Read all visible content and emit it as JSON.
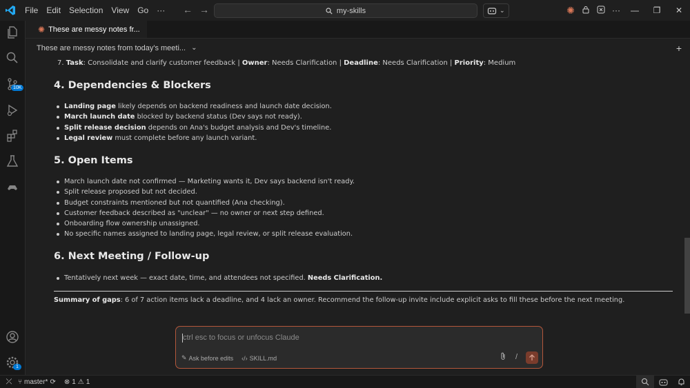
{
  "menu": [
    "File",
    "Edit",
    "Selection",
    "View",
    "Go"
  ],
  "search": {
    "text": "my-skills"
  },
  "tab": {
    "label": "These are messy notes fr..."
  },
  "subheader": {
    "title": "These are messy notes from today's meeti..."
  },
  "activity_badges": {
    "source_control": "10K",
    "settings": "1"
  },
  "doc": {
    "item7": {
      "number": "7.",
      "task_label": "Task",
      "task": ": Consolidate and clarify customer feedback | ",
      "owner_label": "Owner",
      "owner": ": Needs Clarification | ",
      "deadline_label": "Deadline",
      "deadline": ": Needs Clarification | ",
      "priority_label": "Priority",
      "priority": ": Medium"
    },
    "section4": {
      "heading": "4. Dependencies & Blockers",
      "items": [
        {
          "bold": "Landing page",
          "text": " likely depends on backend readiness and launch date decision."
        },
        {
          "bold": "March launch date",
          "text": " blocked by backend status (Dev says not ready)."
        },
        {
          "bold": "Split release decision",
          "text": " depends on Ana's budget analysis and Dev's timeline."
        },
        {
          "bold": "Legal review",
          "text": " must complete before any launch variant."
        }
      ]
    },
    "section5": {
      "heading": "5. Open Items",
      "items": [
        "March launch date not confirmed — Marketing wants it, Dev says backend isn't ready.",
        "Split release proposed but not decided.",
        "Budget constraints mentioned but not quantified (Ana checking).",
        "Customer feedback described as \"unclear\" — no owner or next step defined.",
        "Onboarding flow ownership unassigned.",
        "No specific names assigned to landing page, legal review, or split release evaluation."
      ]
    },
    "section6": {
      "heading": "6. Next Meeting / Follow-up",
      "item_text": "Tentatively next week — exact date, time, and attendees not specified. ",
      "item_bold": "Needs Clarification."
    },
    "summary": {
      "label": "Summary of gaps",
      "text": ": 6 of 7 action items lack a deadline, and 4 lack an owner. Recommend the follow-up invite include explicit asks to fill these before the next meeting."
    }
  },
  "chat": {
    "placeholder": "ctrl esc to focus or unfocus Claude",
    "ask_before_edits": "Ask before edits",
    "file_ref": "SKILL.md",
    "slash": "/"
  },
  "status": {
    "branch": "master*",
    "errors": "1",
    "warnings": "1"
  },
  "colors": {
    "accent": "#0078d4",
    "claude_orange": "#d97757",
    "chat_border": "#b5583b"
  }
}
